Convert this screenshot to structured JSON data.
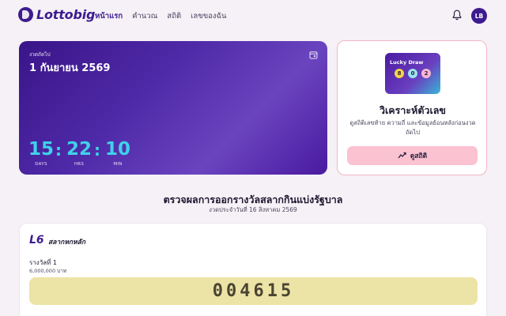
{
  "app": {
    "brand": "Lottobig",
    "user_initials": "LB"
  },
  "nav": {
    "items": [
      "หน้าแรก",
      "คำนวณ",
      "สถิติ",
      "เลขของฉัน"
    ],
    "active_index": 0
  },
  "countdown": {
    "label": "งวดถัดไป",
    "date": "1 กันยายน 2569",
    "days": "15",
    "hours": "22",
    "minutes": "10",
    "days_label": "DAYS",
    "hours_label": "HRS",
    "minutes_label": "MIN"
  },
  "analyze": {
    "thumb_title": "Lucky Draw",
    "balls": [
      {
        "value": "8",
        "color": "#f5d547"
      },
      {
        "value": "0",
        "color": "#9be3f0"
      },
      {
        "value": "2",
        "color": "#f7b6d2"
      }
    ],
    "title": "วิเคราะห์ตัวเลข",
    "description": "ดูสถิติเลขท้าย ความถี่ และข้อมูลย้อนหลังก่อนงวดถัดไป",
    "button_label": "ดูสถิติ"
  },
  "results": {
    "title": "ตรวจผลการออกรางวัลสลากกินแบ่งรัฐบาล",
    "subtitle": "งวดประจำวันที่ 16 สิงหาคม 2569"
  },
  "prize_card": {
    "logo": "L6",
    "name": "สลากหกหลัก",
    "first_prize_label": "รางวัลที่ 1",
    "first_prize_amount": "6,000,000 บาท",
    "first_prize_number": "004615"
  }
}
